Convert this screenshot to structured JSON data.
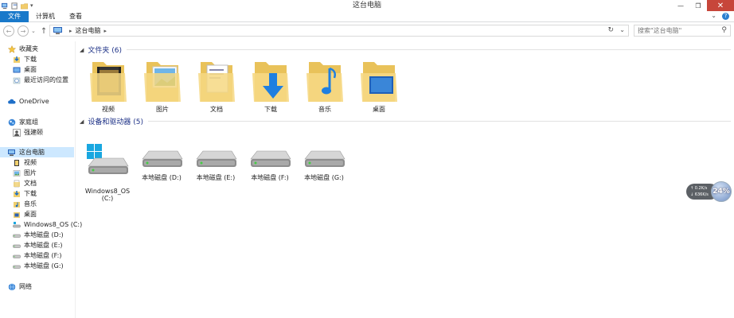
{
  "window": {
    "title": "这台电脑",
    "min": "—",
    "max": "❐",
    "close": "✕"
  },
  "ribbon": {
    "tabs": [
      "文件",
      "计算机",
      "查看"
    ],
    "help": "?",
    "expand": "⌄"
  },
  "nav": {
    "back": "←",
    "forward": "→",
    "recent": "⌄",
    "up": "↑"
  },
  "address": {
    "sep": "▸",
    "location": "这台电脑",
    "sep2": "▸",
    "refresh": "↻",
    "dropdown": "⌄"
  },
  "search": {
    "placeholder": "搜索\"这台电脑\"",
    "icon": "⚲"
  },
  "sidebar": {
    "favorites": {
      "label": "收藏夹",
      "items": [
        "下载",
        "桌面",
        "最近访问的位置"
      ]
    },
    "onedrive": "OneDrive",
    "homegroup": {
      "label": "家庭组",
      "items": [
        "强建颐"
      ]
    },
    "thispc": {
      "label": "这台电脑",
      "items": [
        "视频",
        "图片",
        "文档",
        "下载",
        "音乐",
        "桌面",
        "Windows8_OS (C:)",
        "本地磁盘 (D:)",
        "本地磁盘 (E:)",
        "本地磁盘 (F:)",
        "本地磁盘 (G:)"
      ]
    },
    "network": "网络"
  },
  "content": {
    "folders_header": "文件夹 (6)",
    "folders": [
      "视频",
      "图片",
      "文档",
      "下载",
      "音乐",
      "桌面"
    ],
    "drives_header": "设备和驱动器 (5)",
    "drives": [
      "Windows8_OS\n(C:)",
      "本地磁盘 (D:)",
      "本地磁盘 (E:)",
      "本地磁盘 (F:)",
      "本地磁盘 (G:)"
    ]
  },
  "widget": {
    "up": "0.2K/s",
    "down": "636K/s",
    "percent": "24%"
  }
}
